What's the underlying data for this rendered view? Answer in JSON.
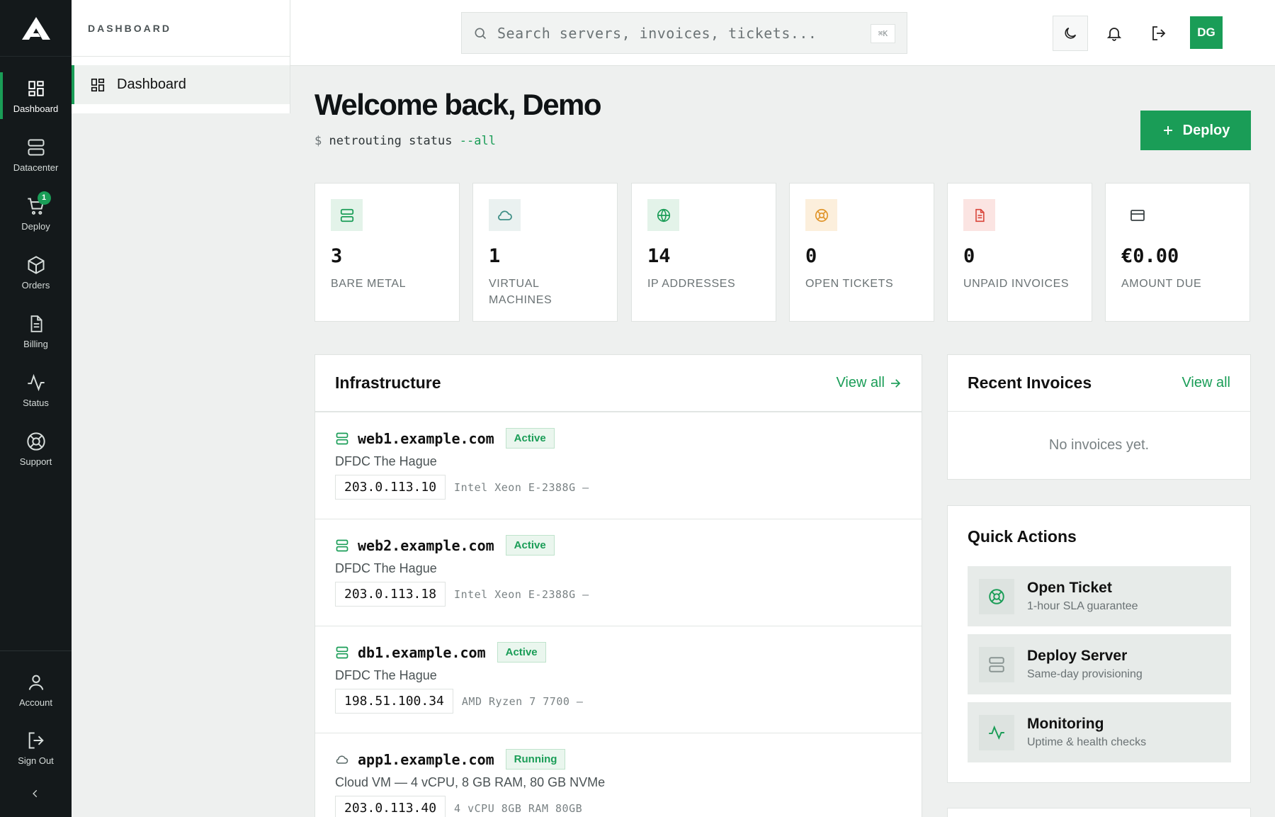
{
  "rail": {
    "items": [
      {
        "label": "Dashboard",
        "icon": "grid-icon"
      },
      {
        "label": "Datacenter",
        "icon": "server-icon"
      },
      {
        "label": "Deploy",
        "icon": "cart-icon",
        "badge": "1"
      },
      {
        "label": "Orders",
        "icon": "box-icon"
      },
      {
        "label": "Billing",
        "icon": "document-icon"
      },
      {
        "label": "Status",
        "icon": "pulse-icon"
      },
      {
        "label": "Support",
        "icon": "lifebuoy-icon"
      }
    ],
    "bottom": [
      {
        "label": "Account",
        "icon": "user-icon"
      },
      {
        "label": "Sign Out",
        "icon": "sign-out-icon"
      }
    ]
  },
  "subnav": {
    "heading": "DASHBOARD",
    "item": "Dashboard"
  },
  "topbar": {
    "search_placeholder": "Search servers, invoices, tickets...",
    "shortcut": "⌘K",
    "avatar": "DG"
  },
  "header": {
    "title": "Welcome back, Demo",
    "cmd_prompt": "$",
    "cmd_text": "netrouting status",
    "cmd_flag": "--all",
    "deploy_label": "Deploy"
  },
  "stats": [
    {
      "value": "3",
      "label": "BARE METAL",
      "icon": "server-icon",
      "color": "#1a9d57"
    },
    {
      "value": "1",
      "label": "VIRTUAL MACHINES",
      "icon": "cloud-icon",
      "color": "#2f8a7e"
    },
    {
      "value": "14",
      "label": "IP ADDRESSES",
      "icon": "globe-icon",
      "color": "#1a9d57"
    },
    {
      "value": "0",
      "label": "OPEN TICKETS",
      "icon": "lifebuoy-icon",
      "color": "#e0952a"
    },
    {
      "value": "0",
      "label": "UNPAID INVOICES",
      "icon": "invoice-icon",
      "color": "#d9453a"
    },
    {
      "value": "€0.00",
      "label": "AMOUNT DUE",
      "icon": "card-icon",
      "color": "#5a6264"
    }
  ],
  "infrastructure": {
    "title": "Infrastructure",
    "view_all": "View all",
    "servers": [
      {
        "host": "web1.example.com",
        "status": "Active",
        "location": "DFDC The Hague",
        "ip": "203.0.113.10",
        "spec": "Intel Xeon E-2388G —",
        "icon": "server-icon"
      },
      {
        "host": "web2.example.com",
        "status": "Active",
        "location": "DFDC The Hague",
        "ip": "203.0.113.18",
        "spec": "Intel Xeon E-2388G —",
        "icon": "server-icon"
      },
      {
        "host": "db1.example.com",
        "status": "Active",
        "location": "DFDC The Hague",
        "ip": "198.51.100.34",
        "spec": "AMD Ryzen 7 7700 —",
        "icon": "server-icon"
      },
      {
        "host": "app1.example.com",
        "status": "Running",
        "location": "Cloud VM — 4 vCPU, 8 GB RAM, 80 GB NVMe",
        "ip": "203.0.113.40",
        "spec": "4 vCPU 8GB RAM 80GB",
        "icon": "cloud-icon"
      }
    ]
  },
  "invoices": {
    "title": "Recent Invoices",
    "view_all": "View all",
    "empty": "No invoices yet."
  },
  "quick_actions": {
    "title": "Quick Actions",
    "items": [
      {
        "name": "Open Ticket",
        "sub": "1-hour SLA guarantee",
        "icon": "lifebuoy-icon"
      },
      {
        "name": "Deploy Server",
        "sub": "Same-day provisioning",
        "icon": "server-icon"
      },
      {
        "name": "Monitoring",
        "sub": "Uptime & health checks",
        "icon": "pulse-icon"
      }
    ]
  }
}
